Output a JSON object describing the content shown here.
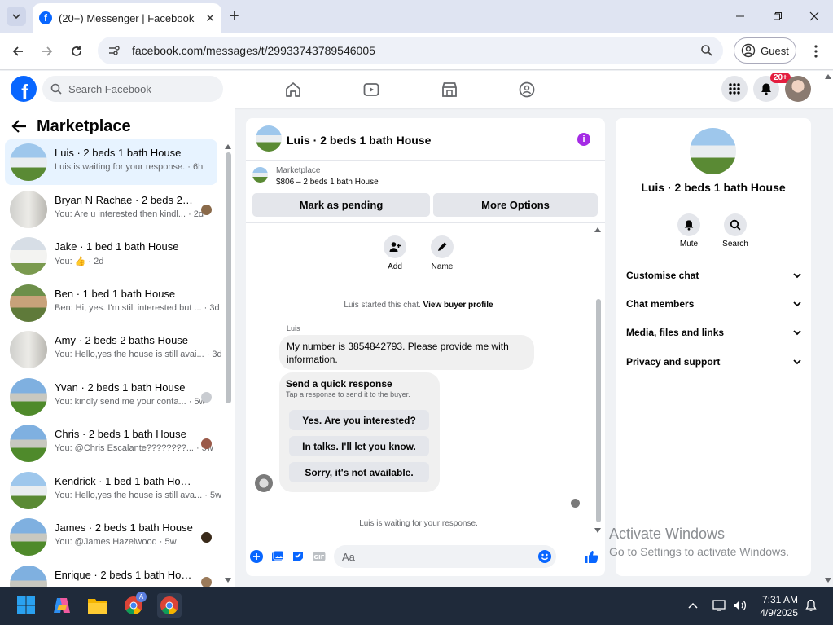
{
  "browser": {
    "tab_title": "(20+) Messenger | Facebook",
    "url": "facebook.com/messages/t/29933743789546005",
    "profile_label": "Guest"
  },
  "fb_header": {
    "search_placeholder": "Search Facebook",
    "notification_badge": "20+"
  },
  "left_panel": {
    "title": "Marketplace",
    "conversations": [
      {
        "name": "Luis · 2 beds 1 bath House",
        "snippet": "Luis is waiting for your response. · 6h",
        "active": true
      },
      {
        "name": "Bryan N Rachae · 2 beds 2 ba...",
        "snippet": "You: Are u interested then kindl... · 2d"
      },
      {
        "name": "Jake · 1 bed 1 bath House",
        "snippet": "You: 👍 · 2d"
      },
      {
        "name": "Ben · 1 bed 1 bath House",
        "snippet": "Ben: Hi, yes. I'm still interested but ... · 3d"
      },
      {
        "name": "Amy · 2 beds 2 baths House",
        "snippet": "You: Hello,yes the house is still avai... · 3d"
      },
      {
        "name": "Yvan · 2 beds 1 bath House",
        "snippet": "You: kindly send me your conta... · 5w"
      },
      {
        "name": "Chris · 2 beds 1 bath House",
        "snippet": "You: @Chris Escalante????????... · 5w"
      },
      {
        "name": "Kendrick · 1 bed 1 bath House",
        "snippet": "You: Hello,yes the house is still ava... · 5w"
      },
      {
        "name": "James · 2 beds 1 bath House",
        "snippet": "You: @James Hazelwood · 5w"
      },
      {
        "name": "Enrique · 2 beds 1 bath House",
        "snippet": ""
      }
    ]
  },
  "chat": {
    "title": "Luis · 2 beds 1 bath House",
    "marketplace_label": "Marketplace",
    "listing_price": "$806 – 2 beds 1 bath House",
    "mark_pending": "Mark as pending",
    "more_options": "More Options",
    "tools": [
      {
        "label": "Add"
      },
      {
        "label": "Name"
      }
    ],
    "started_text": "Luis started this chat.",
    "view_profile": "View buyer profile",
    "sender": "Luis",
    "message": "My number is 3854842793. Please provide me with information.",
    "quick_title": "Send a quick response",
    "quick_sub": "Tap a response to send it to the buyer.",
    "quick_options": [
      "Yes. Are you interested?",
      "In talks. I'll let you know.",
      "Sorry, it's not available."
    ],
    "waiting": "Luis is waiting for your response.",
    "input_placeholder": "Aa"
  },
  "right_panel": {
    "name": "Luis · 2 beds 1 bath House",
    "actions": [
      {
        "label": "Mute"
      },
      {
        "label": "Search"
      }
    ],
    "sections": [
      "Customise chat",
      "Chat members",
      "Media, files and links",
      "Privacy and support"
    ]
  },
  "watermark": {
    "line1": "Activate Windows",
    "line2": "Go to Settings to activate Windows."
  },
  "taskbar": {
    "time": "7:31 AM",
    "date": "4/9/2025"
  },
  "colors": {
    "fb_blue": "#0866ff",
    "active_row": "#e7f3ff",
    "info_purple": "#a52be5"
  }
}
